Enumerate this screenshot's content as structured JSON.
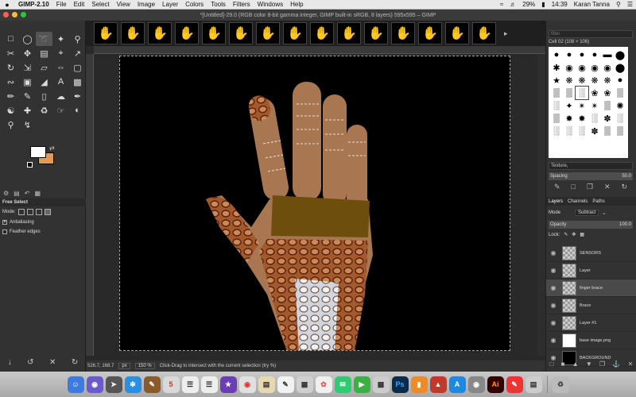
{
  "menubar": {
    "apple": "",
    "app_name": "GIMP-2.10",
    "items": [
      "File",
      "Edit",
      "Select",
      "View",
      "Image",
      "Layer",
      "Colors",
      "Tools",
      "Filters",
      "Windows",
      "Help"
    ],
    "battery": "29%",
    "time": "14:39",
    "user": "Karan Tanna"
  },
  "window": {
    "title": "*[Untitled]-29.0 (RGB color 8-bit gamma integer, GIMP built-in sRGB, 8 layers) 595x595 – GIMP"
  },
  "toolbox": {
    "colors": {
      "foreground": "#ffffff",
      "background": "#e09a57"
    },
    "options": {
      "title": "Free Select",
      "mode_label": "Mode:",
      "antialiasing_label": "Antialiasing",
      "antialiasing_checked": true,
      "feather_label": "Feather edges",
      "feather_checked": false
    }
  },
  "canvas": {
    "status": {
      "coords": "526.7, 168.7",
      "unit": "px",
      "zoom": "150 %",
      "message": "Click-Drag to intersect with the current selection (try %)"
    }
  },
  "brushes": {
    "filter_placeholder": "filter",
    "current": "Cell 02 (108 × 106)",
    "tag_placeholder": "Texture,",
    "spacing_label": "Spacing",
    "spacing_value": "50.0"
  },
  "layers_panel": {
    "tabs": [
      "Layers",
      "Channels",
      "Paths"
    ],
    "mode_label": "Mode",
    "mode_value": "Subtract",
    "opacity_label": "Opacity",
    "opacity_value": "100.0",
    "lock_label": "Lock:",
    "layers": [
      {
        "name": "SENSORS"
      },
      {
        "name": "Layer"
      },
      {
        "name": "finger brace"
      },
      {
        "name": "Brace"
      },
      {
        "name": "Layer #1"
      },
      {
        "name": "base image.png"
      },
      {
        "name": "BACKGROUND"
      }
    ]
  }
}
